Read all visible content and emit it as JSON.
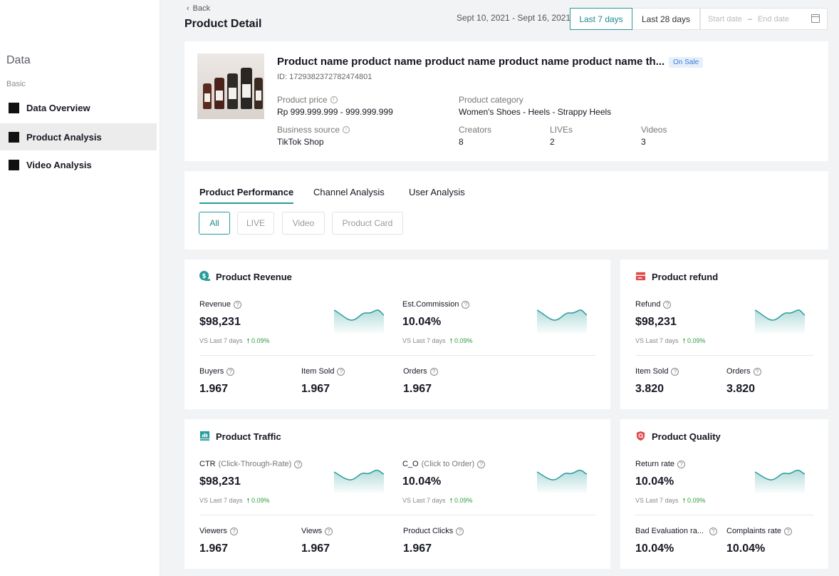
{
  "sidebar": {
    "title": "Data",
    "section": "Basic",
    "items": [
      {
        "label": "Data Overview",
        "active": false
      },
      {
        "label": "Product Analysis",
        "active": true
      },
      {
        "label": "Video Analysis",
        "active": false
      }
    ]
  },
  "header": {
    "back_label": "Back",
    "title": "Product Detail",
    "date_range_text": "Sept 10, 2021 - Sept 16, 2021",
    "last7_label": "Last 7 days",
    "last28_label": "Last 28 days",
    "start_placeholder": "Start date",
    "separator": "–",
    "end_placeholder": "End date"
  },
  "product": {
    "name": "Product name product name  product name product name  product name th...",
    "status_badge": "On Sale",
    "id_text": "ID: 1729382372782474801",
    "price_label": "Product price",
    "price_value": "Rp 999.999.999 - 999.999.999",
    "category_label": "Product category",
    "category_value": "Women's Shoes - Heels - Strappy Heels",
    "source_label": "Business source",
    "source_value": "TikTok Shop",
    "creators_label": "Creators",
    "creators_value": "8",
    "lives_label": "LIVEs",
    "lives_value": "2",
    "videos_label": "Videos",
    "videos_value": "3"
  },
  "tabs": [
    {
      "label": "Product Performance",
      "active": true
    },
    {
      "label": "Channel Analysis",
      "active": false
    },
    {
      "label": "User Analysis",
      "active": false
    }
  ],
  "filters": [
    {
      "label": "All",
      "active": true
    },
    {
      "label": "LIVE",
      "active": false
    },
    {
      "label": "Video",
      "active": false
    },
    {
      "label": "Product Card",
      "active": false
    }
  ],
  "revenue": {
    "title": "Product Revenue",
    "m1": {
      "label": "Revenue",
      "value": "$98,231",
      "cmp": "VS Last 7 days",
      "delta": "0.09%"
    },
    "m2": {
      "label": "Est.Commission",
      "value": "10.04%",
      "cmp": "VS Last 7 days",
      "delta": "0.09%"
    },
    "s1": {
      "label": "Buyers",
      "value": "1.967"
    },
    "s2": {
      "label": "Item Sold",
      "value": "1.967"
    },
    "s3": {
      "label": "Orders",
      "value": "1.967"
    }
  },
  "refund": {
    "title": "Product refund",
    "m1": {
      "label": "Refund",
      "value": "$98,231",
      "cmp": "VS Last 7 days",
      "delta": "0.09%"
    },
    "s1": {
      "label": "Item Sold",
      "value": "3.820"
    },
    "s2": {
      "label": "Orders",
      "value": "3.820"
    }
  },
  "traffic": {
    "title": "Product Traffic",
    "m1": {
      "label": "CTR",
      "sub": "(Click-Through-Rate)",
      "value": "$98,231",
      "cmp": "VS Last 7 days",
      "delta": "0.09%"
    },
    "m2": {
      "label": "C_O",
      "sub": "(Click to Order)",
      "value": "10.04%",
      "cmp": "VS Last 7 days",
      "delta": "0.09%"
    },
    "s1": {
      "label": "Viewers",
      "value": "1.967"
    },
    "s2": {
      "label": "Views",
      "value": "1.967"
    },
    "s3": {
      "label": "Product Clicks",
      "value": "1.967"
    }
  },
  "quality": {
    "title": "Product Quality",
    "m1": {
      "label": "Return rate",
      "value": "10.04%",
      "cmp": "VS Last 7 days",
      "delta": "0.09%"
    },
    "s1": {
      "label": "Bad Evaluation ra...",
      "value": "10.04%"
    },
    "s2": {
      "label": "Complaints rate",
      "value": "10.04%"
    }
  },
  "colors": {
    "accent": "#2a9b9b",
    "positive": "#2c9d3d",
    "refund_icon": "#e04b4b",
    "badge_bg": "#e6f0fb"
  }
}
